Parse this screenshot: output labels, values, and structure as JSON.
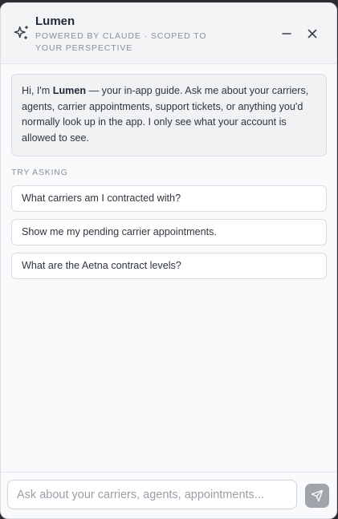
{
  "header": {
    "title": "Lumen",
    "subtitle": "POWERED BY CLAUDE · SCOPED TO YOUR PERSPECTIVE",
    "icons": [
      "sparkle-icon",
      "minimize-icon",
      "close-icon"
    ]
  },
  "intro": {
    "greeting": "Hi, I'm ",
    "name": "Lumen",
    "message": " — your in-app guide. Ask me about your carriers, agents, carrier appointments, support tickets, or anything you'd normally look up in the app. I only see what your account is allowed to see."
  },
  "suggestions": {
    "label": "TRY ASKING",
    "items": [
      "What carriers am I contracted with?",
      "Show me my pending carrier appointments.",
      "What are the Aetna contract levels?"
    ]
  },
  "composer": {
    "placeholder": "Ask about your carriers, agents, appointments...",
    "value": "",
    "send_icon": "send-icon"
  },
  "colors": {
    "panel_bg": "#f9fafb",
    "header_bg": "#f3f4f6",
    "send_button_bg": "#a1a5ab"
  }
}
